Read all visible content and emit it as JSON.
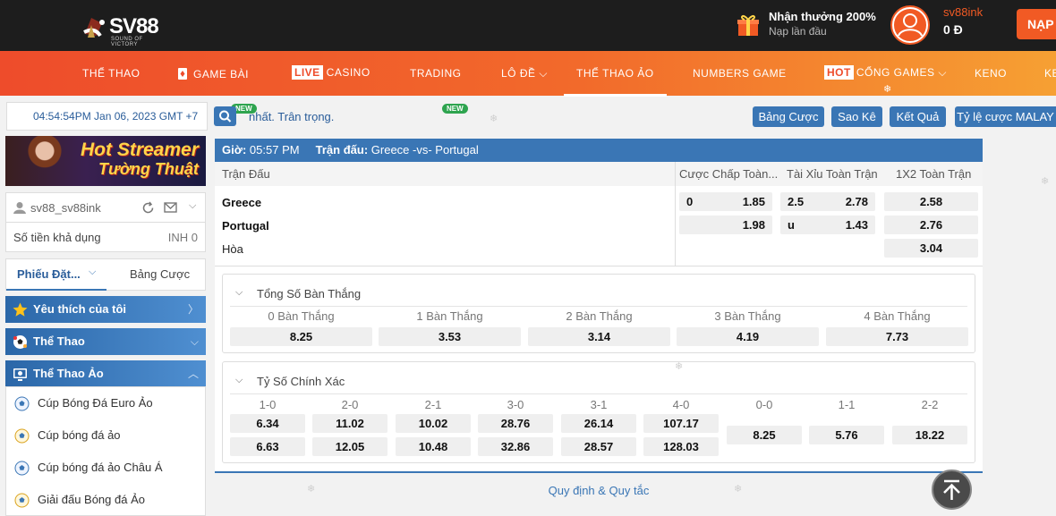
{
  "header": {
    "logo_text": "SV88",
    "logo_sub": "SOUND OF VICTORY",
    "promo_title": "Nhận thưởng 200%",
    "promo_sub": "Nạp lần đầu",
    "username": "sv88ink",
    "balance": "0 Đ",
    "deposit_label": "NẠP"
  },
  "nav": [
    {
      "label": "THỂ THAO"
    },
    {
      "label": "GAME BÀI",
      "badge": "NEW"
    },
    {
      "prefix": "LIVE",
      "label": "CASINO"
    },
    {
      "label": "TRADING",
      "badge": "NEW"
    },
    {
      "label": "LÔ ĐỀ"
    },
    {
      "label": "THỂ THAO ẢO"
    },
    {
      "label": "NUMBERS GAME"
    },
    {
      "prefix": "HOT",
      "label": "CỔNG GAMES"
    },
    {
      "label": "KENO"
    },
    {
      "label": "KE"
    }
  ],
  "toolbar": {
    "datetime": "04:54:54PM Jan 06, 2023 GMT +7",
    "marquee": "nhất. Trân trọng.",
    "buttons": [
      "Bảng Cược",
      "Sao Kê",
      "Kết Quả",
      "Tỷ lệ cược MALAY"
    ]
  },
  "sidebar": {
    "banner_line1": "Hot Streamer",
    "banner_line2": "Tường Thuật",
    "user": "sv88_sv88ink",
    "balance_label": "Số tiền khả dụng",
    "balance_value": "INH 0",
    "tab_active": "Phiếu Đặt...",
    "tab_other": "Bảng Cược",
    "sections": [
      {
        "label": "Yêu thích của tôi"
      },
      {
        "label": "Thể Thao"
      },
      {
        "label": "Thể Thao Ảo"
      }
    ],
    "items": [
      {
        "label": "Cúp Bóng Đá Euro Ảo"
      },
      {
        "label": "Cúp bóng đá ảo"
      },
      {
        "label": "Cúp bóng đá ảo Châu Á"
      },
      {
        "label": "Giải đấu Bóng đá Ảo"
      }
    ]
  },
  "match": {
    "time_label": "Giờ:",
    "time": "05:57 PM",
    "match_label": "Trận đấu:",
    "match": "Greece -vs- Portugal",
    "col_match": "Trận Đấu",
    "col_handicap": "Cược Chấp Toàn...",
    "col_ou": "Tài Xỉu Toàn Trận",
    "col_1x2": "1X2 Toàn Trận",
    "home": "Greece",
    "away": "Portugal",
    "draw": "Hòa",
    "hdp_home_line": "0",
    "hdp_home_odds": "1.85",
    "hdp_away_odds": "1.98",
    "ou_line": "2.5",
    "ou_over_odds": "2.78",
    "ou_under_label": "u",
    "ou_under_odds": "1.43",
    "x12_home": "2.58",
    "x12_away": "2.76",
    "x12_draw": "3.04"
  },
  "total_goals": {
    "title": "Tổng Số Bàn Thắng",
    "items": [
      {
        "label": "0 Bàn Thắng",
        "odds": "8.25"
      },
      {
        "label": "1 Bàn Thắng",
        "odds": "3.53"
      },
      {
        "label": "2 Bàn Thắng",
        "odds": "3.14"
      },
      {
        "label": "3 Bàn Thắng",
        "odds": "4.19"
      },
      {
        "label": "4 Bàn Thắng",
        "odds": "7.73"
      }
    ]
  },
  "correct_score": {
    "title": "Tỷ Số Chính Xác",
    "pairs": [
      {
        "label": "1-0",
        "home": "6.34",
        "away": "6.63"
      },
      {
        "label": "2-0",
        "home": "11.02",
        "away": "12.05"
      },
      {
        "label": "2-1",
        "home": "10.02",
        "away": "10.48"
      },
      {
        "label": "3-0",
        "home": "28.76",
        "away": "32.86"
      },
      {
        "label": "3-1",
        "home": "26.14",
        "away": "28.57"
      },
      {
        "label": "4-0",
        "home": "107.17",
        "away": "128.03"
      }
    ],
    "draws": [
      {
        "label": "0-0",
        "odds": "8.25"
      },
      {
        "label": "1-1",
        "odds": "5.76"
      },
      {
        "label": "2-2",
        "odds": "18.22"
      }
    ]
  },
  "footer": {
    "rules": "Quy định & Quy tắc"
  },
  "colors": {
    "brand_orange": "#f15a24",
    "primary_blue": "#3a76b5"
  }
}
